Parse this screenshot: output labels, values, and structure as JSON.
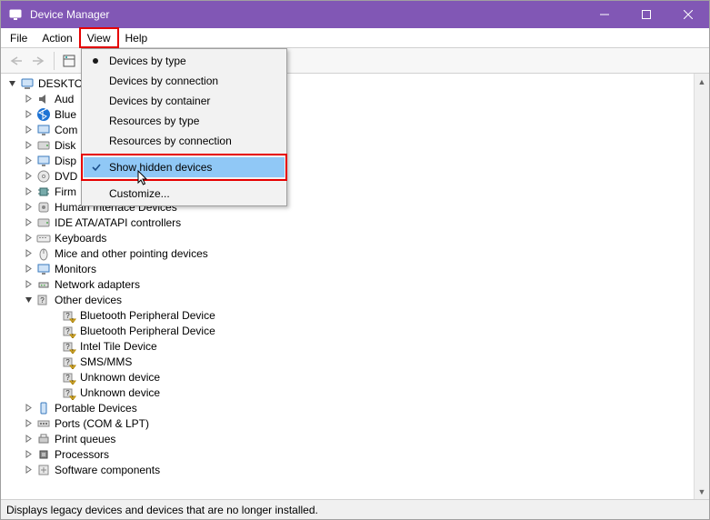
{
  "window": {
    "title": "Device Manager"
  },
  "menubar": {
    "file": "File",
    "action": "Action",
    "view": "View",
    "help": "Help"
  },
  "view_menu": {
    "devices_by_type": "Devices by type",
    "devices_by_connection": "Devices by connection",
    "devices_by_container": "Devices by container",
    "resources_by_type": "Resources by type",
    "resources_by_connection": "Resources by connection",
    "show_hidden_devices": "Show hidden devices",
    "customize": "Customize..."
  },
  "tree": {
    "root": "DESKTO",
    "items": [
      {
        "label": "Aud",
        "expand": "closed"
      },
      {
        "label": "Blue",
        "expand": "closed"
      },
      {
        "label": "Com",
        "expand": "closed"
      },
      {
        "label": "Disk",
        "expand": "closed"
      },
      {
        "label": "Disp",
        "expand": "closed"
      },
      {
        "label": "DVD",
        "expand": "closed"
      },
      {
        "label": "Firm",
        "expand": "closed"
      },
      {
        "label": "Human Interface Devices",
        "expand": "closed"
      },
      {
        "label": "IDE ATA/ATAPI controllers",
        "expand": "closed"
      },
      {
        "label": "Keyboards",
        "expand": "closed"
      },
      {
        "label": "Mice and other pointing devices",
        "expand": "closed"
      },
      {
        "label": "Monitors",
        "expand": "closed"
      },
      {
        "label": "Network adapters",
        "expand": "closed"
      },
      {
        "label": "Other devices",
        "expand": "open",
        "children": [
          "Bluetooth Peripheral Device",
          "Bluetooth Peripheral Device",
          "Intel Tile Device",
          "SMS/MMS",
          "Unknown device",
          "Unknown device"
        ]
      },
      {
        "label": "Portable Devices",
        "expand": "closed"
      },
      {
        "label": "Ports (COM & LPT)",
        "expand": "closed"
      },
      {
        "label": "Print queues",
        "expand": "closed"
      },
      {
        "label": "Processors",
        "expand": "closed"
      },
      {
        "label": "Software components",
        "expand": "closed"
      }
    ]
  },
  "statusbar": {
    "text": "Displays legacy devices and devices that are no longer installed."
  }
}
